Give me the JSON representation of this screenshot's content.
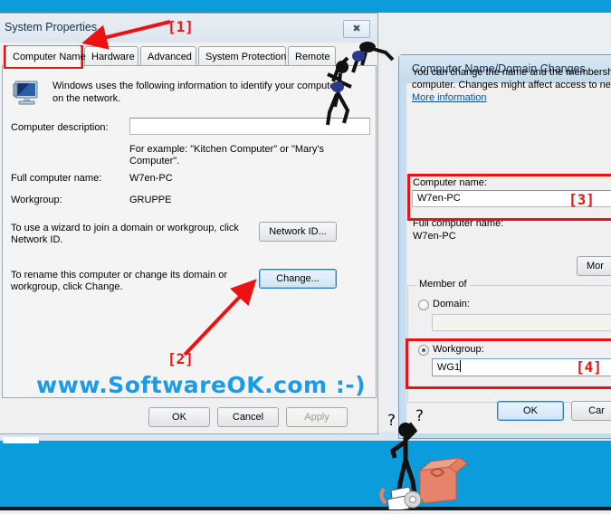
{
  "system_properties": {
    "title": "System Properties",
    "close_icon": "close-x-icon",
    "tabs": [
      {
        "label": "Computer Name",
        "active": true
      },
      {
        "label": "Hardware",
        "active": false
      },
      {
        "label": "Advanced",
        "active": false
      },
      {
        "label": "System Protection",
        "active": false
      },
      {
        "label": "Remote",
        "active": false
      }
    ],
    "icon": "computer-monitor-icon",
    "intro_line1": "Windows uses the following information to identify your computer",
    "intro_line2": "on the network.",
    "computer_description_label": "Computer description:",
    "computer_description_value": "",
    "example_line1": "For example: \"Kitchen Computer\" or \"Mary's",
    "example_line2": "Computer\".",
    "full_computer_name_label": "Full computer name:",
    "full_computer_name_value": "W7en-PC",
    "workgroup_label": "Workgroup:",
    "workgroup_value": "GRUPPE",
    "wizard_line1": "To use a wizard to join a domain or workgroup, click",
    "wizard_line2": "Network ID.",
    "network_id_button": "Network ID...",
    "rename_line1": "To rename this computer or change its domain or",
    "rename_line2": "workgroup, click Change.",
    "change_button": "Change...",
    "ok_button": "OK",
    "cancel_button": "Cancel",
    "apply_button": "Apply"
  },
  "watermark": {
    "text": "www.SoftwareOK.com :-)",
    "color": "#1b9be8"
  },
  "dialog": {
    "title": "Computer Name/Domain Changes",
    "desc_line1": "You can change the name and the membership of this",
    "desc_line2": "computer. Changes might affect access to network reso",
    "more_information_link": "More information",
    "computer_name_label": "Computer name:",
    "computer_name_value": "W7en-PC",
    "full_computer_name_label": "Full computer name:",
    "full_computer_name_value": "W7en-PC",
    "more_button": "Mor",
    "member_of_legend": "Member of",
    "domain_label": "Domain:",
    "domain_value": "",
    "domain_selected": false,
    "workgroup_label": "Workgroup:",
    "workgroup_value": "WG1",
    "workgroup_selected": true,
    "ok_button": "OK",
    "cancel_button": "Car"
  },
  "annotations": {
    "marker_1": "[1]",
    "marker_2": "[2]",
    "marker_3": "[3]",
    "marker_4": "[4]",
    "color": "#ee1111"
  }
}
